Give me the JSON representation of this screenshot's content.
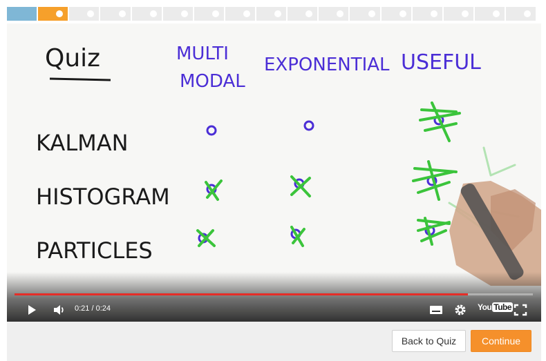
{
  "progress": {
    "segments": [
      "done",
      "current",
      "todo",
      "todo",
      "todo",
      "todo",
      "todo",
      "todo",
      "todo",
      "todo",
      "todo",
      "todo",
      "todo",
      "todo",
      "todo",
      "todo",
      "todo"
    ],
    "colors": {
      "done": "#7fb7d6",
      "current": "#f6a02b",
      "todo": "#ebebeb"
    }
  },
  "whiteboard": {
    "title": "Quiz",
    "columns": [
      "MULTI",
      "MODAL",
      "EXPONENTIAL",
      "USEFUL"
    ],
    "rows": [
      "KALMAN",
      "HISTOGRAM",
      "PARTICLES"
    ],
    "ink_colors": {
      "text": "#1a1a1a",
      "headers": "#4b2ed6",
      "marks": "#3bc43b"
    }
  },
  "player": {
    "time": "0:21 / 0:24",
    "progress_fraction": 0.875,
    "logo_you": "You",
    "logo_tube": "Tube",
    "accent": "#e52d27"
  },
  "footer": {
    "back_label": "Back to Quiz",
    "continue_label": "Continue",
    "continue_color": "#f5902b"
  }
}
